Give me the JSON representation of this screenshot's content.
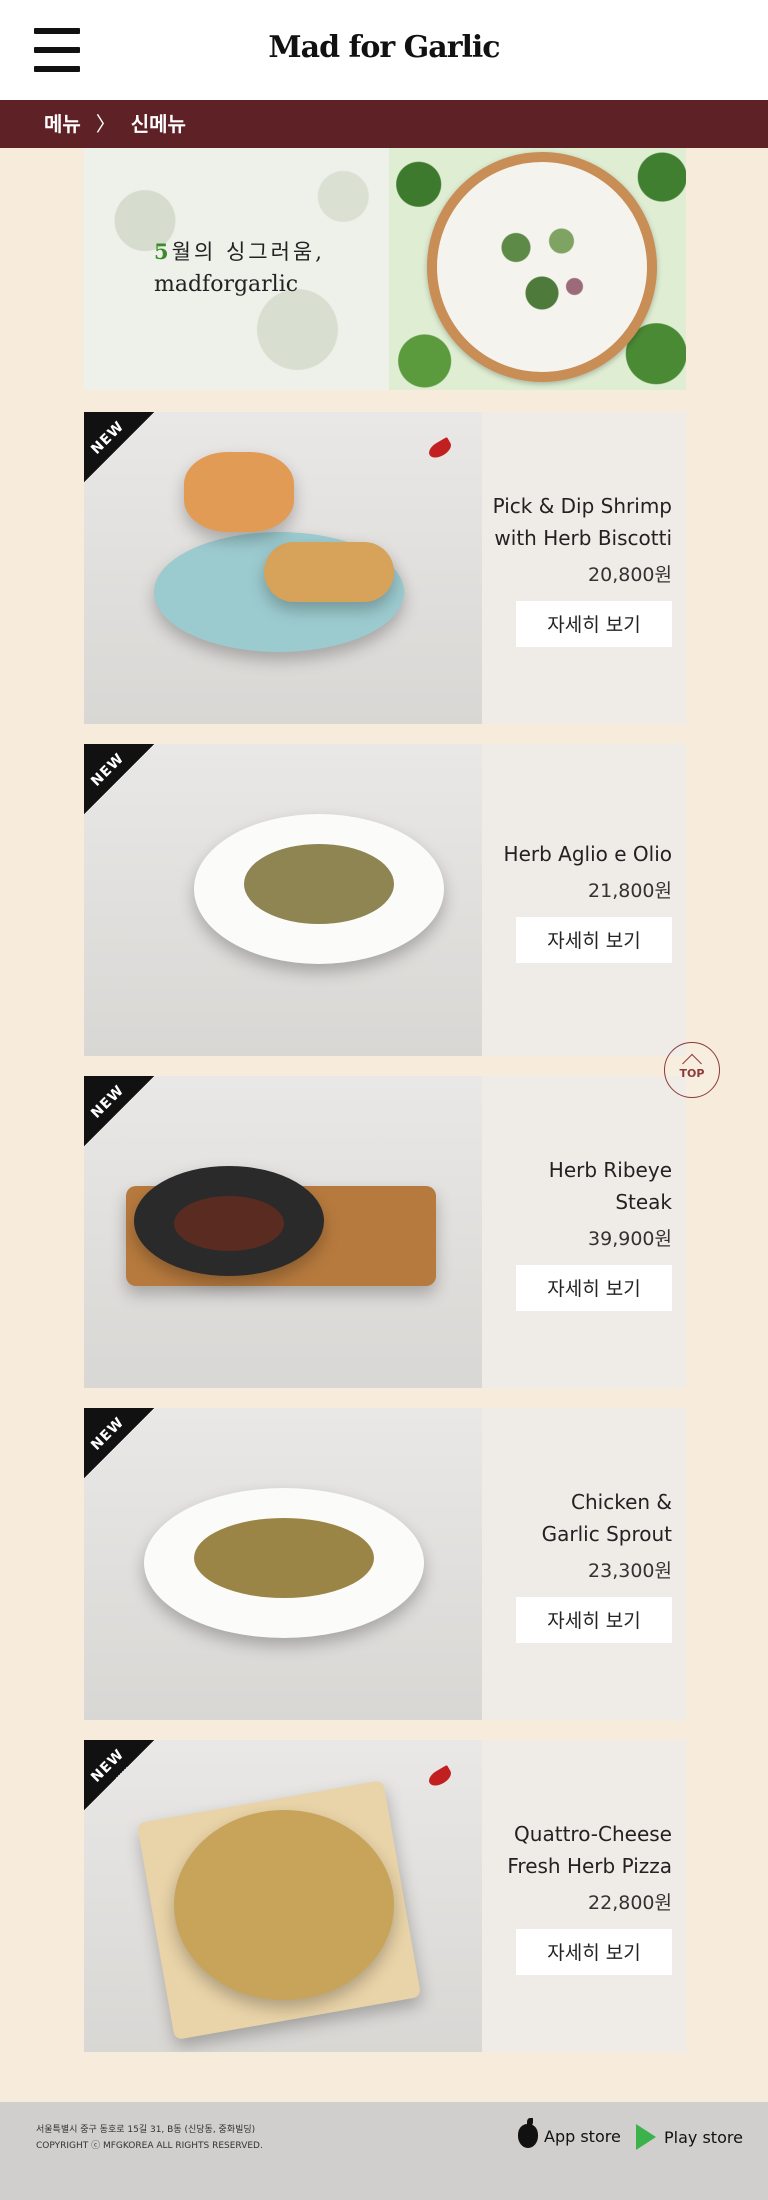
{
  "header": {
    "logo": "Mad for Garlic",
    "breadcrumb": [
      "메뉴",
      "신메뉴"
    ],
    "breadcrumb_sep": "〉"
  },
  "banner": {
    "line1_num": "5",
    "line1_rest": "월의 싱그러움,",
    "line2": "madforgarlic"
  },
  "menu": {
    "new_label": "NEW",
    "detail_label": "자세히 보기",
    "items": [
      {
        "name_line1": "Pick & Dip Shrimp",
        "name_line2": "with Herb Biscotti",
        "price": "20,800원",
        "spicy": true
      },
      {
        "name_line1": "Herb Aglio e Olio",
        "name_line2": "",
        "price": "21,800원",
        "spicy": false
      },
      {
        "name_line1": "Herb Ribeye Steak",
        "name_line2": "",
        "price": "39,900원",
        "spicy": false
      },
      {
        "name_line1": "Chicken &",
        "name_line2": "Garlic Sprout",
        "price": "23,300원",
        "spicy": false
      },
      {
        "name_line1": "Quattro-Cheese",
        "name_line2": "Fresh Herb Pizza",
        "price": "22,800원",
        "spicy": true
      }
    ]
  },
  "top_button": "TOP",
  "footer": {
    "address": "서울특별시 중구 동호로 15길 31, B동 (신당동, 중화빌딩)",
    "copyright": "COPYRIGHT ⓒ MFGKOREA ALL RIGHTS RESERVED.",
    "app_store": "App store",
    "play_store": "Play store"
  },
  "colors": {
    "breadcrumb_bg": "#5e2125",
    "page_bg": "#f7ecdc",
    "footer_bg": "#d1cfcd",
    "chili": "#c22020"
  }
}
